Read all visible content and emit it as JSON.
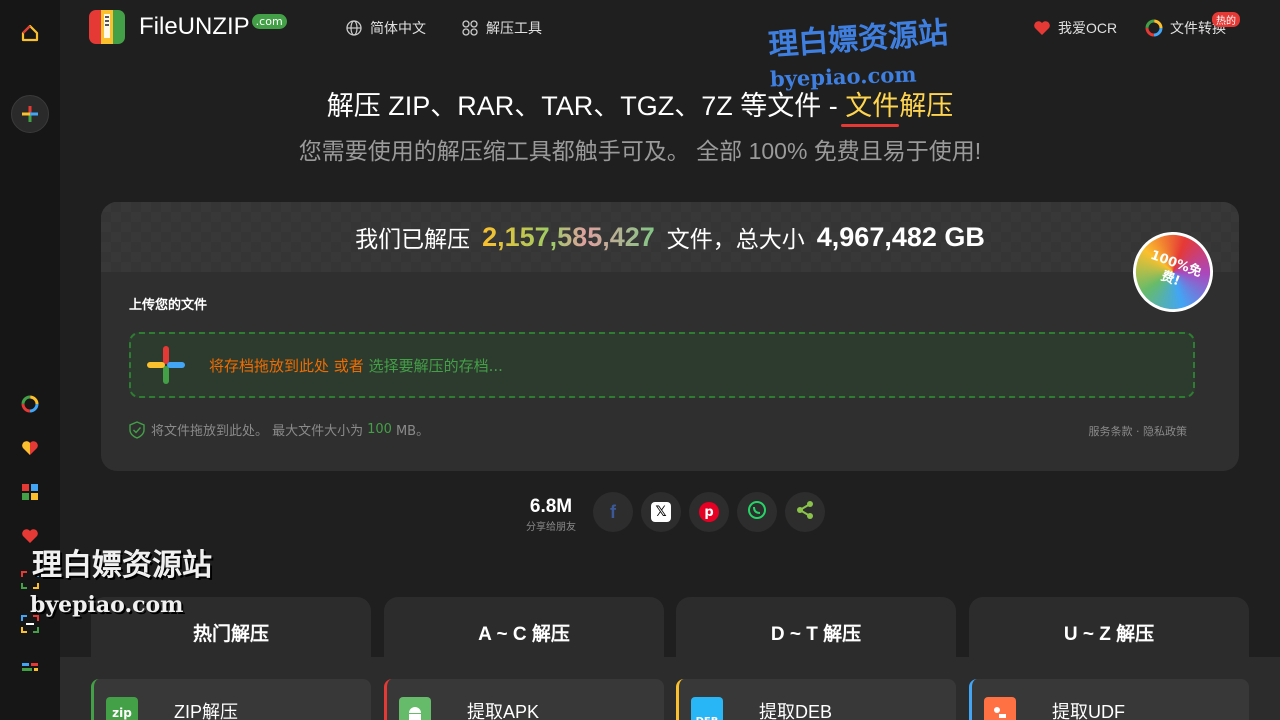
{
  "header": {
    "logo_text": "FileUNZIP",
    "logo_com": ".com",
    "nav": [
      {
        "label": "简体中文",
        "icon": "globe-icon"
      },
      {
        "label": "解压工具",
        "icon": "apps-icon"
      },
      {
        "label": "我爱OCR",
        "icon": "heart-icon"
      },
      {
        "label": "文件转换",
        "icon": "convert-icon",
        "badge": "热的"
      }
    ]
  },
  "hero": {
    "title_main": "解压 ZIP、RAR、TAR、TGZ、7Z 等文件 - ",
    "title_accent": "文件解压",
    "subtitle": "您需要使用的解压缩工具都触手可及。 全部 100% 免费且易于使用!"
  },
  "stats": {
    "prefix": "我们已解压",
    "files_count": "2,157,585,427",
    "middle": "文件，总大小",
    "total_size": "4,967,482 GB"
  },
  "badge_free": "100%免费!",
  "upload": {
    "label": "上传您的文件",
    "drop_text": "将存档拖放到此处 或者",
    "choose_text": "选择要解压的存档...",
    "info_prefix": "将文件拖放到此处。 最大文件大小为",
    "max_size": "100",
    "info_unit": "MB。",
    "terms": "服务条款 · 隐私政策"
  },
  "share": {
    "count": "6.8M",
    "label": "分享给朋友",
    "buttons": [
      "facebook-icon",
      "x-icon",
      "pinterest-icon",
      "whatsapp-icon",
      "share-icon"
    ]
  },
  "tabs": [
    "热门解压",
    "A ~ C 解压",
    "D ~ T 解压",
    "U ~ Z 解压"
  ],
  "tools": [
    {
      "label": "ZIP解压",
      "icon_text": "zip",
      "color": "#43a047"
    },
    {
      "label": "提取APK",
      "icon_text": "",
      "color": "#66bb6a"
    },
    {
      "label": "提取DEB",
      "icon_text": "DEB",
      "color": "#29b6f6"
    },
    {
      "label": "提取UDF",
      "icon_text": "",
      "color": "#ff7043"
    }
  ],
  "watermark": {
    "cn": "理白嫖资源站",
    "en": "byepiao.com"
  },
  "colors": {
    "accent_yellow": "#ffd54f",
    "accent_green": "#43a047",
    "accent_orange": "#ef6c00",
    "accent_red": "#e53935"
  }
}
